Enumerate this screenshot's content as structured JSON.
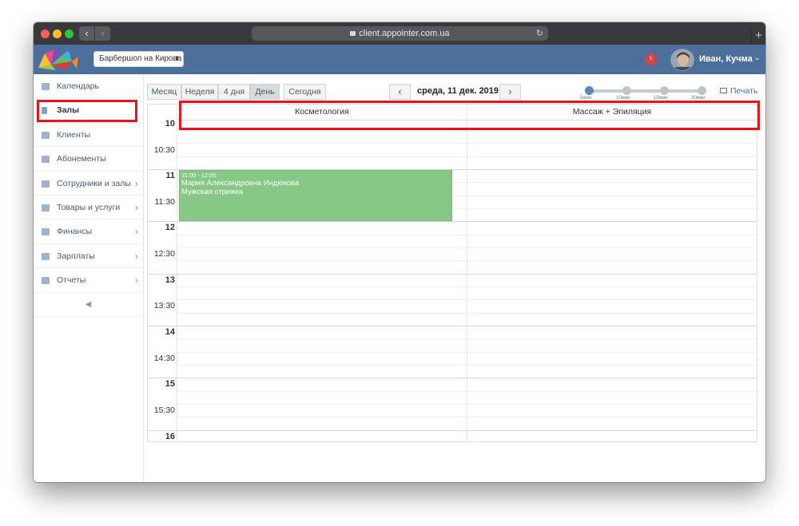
{
  "browser": {
    "url": "client.appointer.com.ua"
  },
  "header": {
    "branch_selector": "Барбершоп на Кирова",
    "notifications_count": "5",
    "user_name": "Иван, Кучма"
  },
  "sidebar": {
    "items": [
      {
        "label": "Календарь",
        "icon": "calendar-icon",
        "has_submenu": false,
        "active": false
      },
      {
        "label": "Залы",
        "icon": "bookmark-icon",
        "has_submenu": false,
        "active": true
      },
      {
        "label": "Клиенты",
        "icon": "users-icon",
        "has_submenu": false,
        "active": false
      },
      {
        "label": "Абонементы",
        "icon": "card-icon",
        "has_submenu": false,
        "active": false
      },
      {
        "label": "Сотрудники и залы",
        "icon": "id-card-icon",
        "has_submenu": true,
        "active": false
      },
      {
        "label": "Товары и услуги",
        "icon": "card-icon",
        "has_submenu": true,
        "active": false
      },
      {
        "label": "Финансы",
        "icon": "money-icon",
        "has_submenu": true,
        "active": false
      },
      {
        "label": "Зарплаты",
        "icon": "calculator-icon",
        "has_submenu": true,
        "active": false
      },
      {
        "label": "Отчеты",
        "icon": "bar-chart-icon",
        "has_submenu": true,
        "active": false
      }
    ],
    "collapse_icon": "collapse-left-icon"
  },
  "toolbar": {
    "views": [
      {
        "label": "Месяц",
        "active": false
      },
      {
        "label": "Неделя",
        "active": false
      },
      {
        "label": "4 дня",
        "active": false
      },
      {
        "label": "День",
        "active": true
      }
    ],
    "today_label": "Сегодня",
    "date_title": "среда, 11 дек. 2019",
    "interval_labels": [
      "5мин",
      "10мин",
      "15мин",
      "30мин"
    ],
    "interval_selected_index": 0,
    "print_label": "Печать"
  },
  "calendar": {
    "columns": [
      "Косметология",
      "Массаж + Эпиляция"
    ],
    "time_slots": [
      {
        "label": "10",
        "hour": true
      },
      {
        "label": "10:30",
        "hour": false
      },
      {
        "label": "11",
        "hour": true
      },
      {
        "label": "11:30",
        "hour": false
      },
      {
        "label": "12",
        "hour": true
      },
      {
        "label": "12:30",
        "hour": false
      },
      {
        "label": "13",
        "hour": true
      },
      {
        "label": "13:30",
        "hour": false
      },
      {
        "label": "14",
        "hour": true
      },
      {
        "label": "14:30",
        "hour": false
      },
      {
        "label": "15",
        "hour": true
      },
      {
        "label": "15:30",
        "hour": false
      },
      {
        "label": "16",
        "hour": true
      }
    ],
    "events": [
      {
        "time": "11:00 - 12:00",
        "client": "Мария Александровна Индюкова",
        "service": "Мужская стрижка",
        "column": 0
      }
    ]
  },
  "colors": {
    "app_bar": "#4c6f9c",
    "event": "#87c886",
    "highlight": "#e8141a",
    "notification": "#e8413a"
  }
}
